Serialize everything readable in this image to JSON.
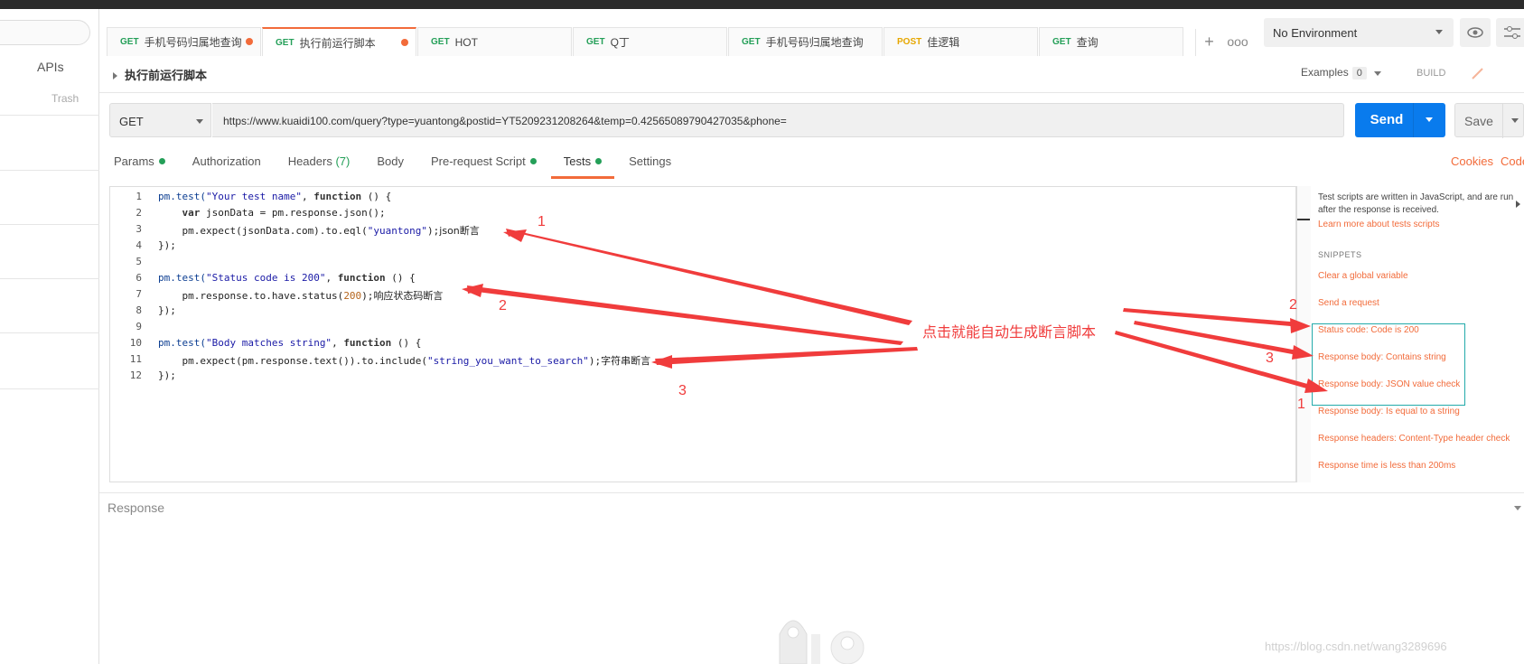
{
  "sidebar": {
    "apis": "APIs",
    "trash": "Trash"
  },
  "tabs": [
    {
      "method": "GET",
      "label": "手机号码归属地查询",
      "modified": true,
      "active": false
    },
    {
      "method": "GET",
      "label": "执行前运行脚本",
      "modified": true,
      "active": true
    },
    {
      "method": "GET",
      "label": "HOT",
      "modified": false,
      "active": false
    },
    {
      "method": "GET",
      "label": "Q丁",
      "modified": false,
      "active": false
    },
    {
      "method": "GET",
      "label": "手机号码归属地查询",
      "modified": false,
      "active": false
    },
    {
      "method": "POST",
      "label": "佳逻辑",
      "modified": false,
      "active": false
    },
    {
      "method": "GET",
      "label": "查询",
      "modified": false,
      "active": false
    }
  ],
  "tab_add": "+",
  "tab_more": "ooo",
  "environment": {
    "selected": "No Environment"
  },
  "request": {
    "title": "执行前运行脚本",
    "examples_label": "Examples",
    "examples_count": "0",
    "build_label": "BUILD",
    "method": "GET",
    "url": "https://www.kuaidi100.com/query?type=yuantong&postid=YT5209231208264&temp=0.42565089790427035&phone=",
    "send_label": "Send",
    "save_label": "Save"
  },
  "subtabs": {
    "params": "Params",
    "authorization": "Authorization",
    "headers": "Headers",
    "headers_count": "(7)",
    "body": "Body",
    "prerequest": "Pre-request Script",
    "tests": "Tests",
    "settings": "Settings",
    "cookies": "Cookies",
    "code": "Code"
  },
  "editor": {
    "line_numbers": [
      "1",
      "2",
      "3",
      "4",
      "5",
      "6",
      "7",
      "8",
      "9",
      "10",
      "11",
      "12"
    ],
    "notes": {
      "json": "json断言",
      "status": "响应状态码断言",
      "string": "字符串断言"
    }
  },
  "help": {
    "description": "Test scripts are written in JavaScript, and are run after the response is received.",
    "learn_more": "Learn more about tests scripts",
    "snippets_heading": "SNIPPETS",
    "snippets": [
      "Clear a global variable",
      "Send a request",
      "Status code: Code is 200",
      "Response body: Contains string",
      "Response body: JSON value check",
      "Response body: Is equal to a string",
      "Response headers: Content-Type header check",
      "Response time is less than 200ms"
    ]
  },
  "response": {
    "label": "Response"
  },
  "annotations": {
    "main": "点击就能自动生成断言脚本",
    "n1": "1",
    "n2": "2",
    "n3": "3"
  },
  "watermark": "https://blog.csdn.net/wang3289696",
  "colors": {
    "accent": "#f26b3a",
    "send": "#097bed",
    "get": "#249f58",
    "post": "#e6a700",
    "annotation": "#f03c3c"
  }
}
